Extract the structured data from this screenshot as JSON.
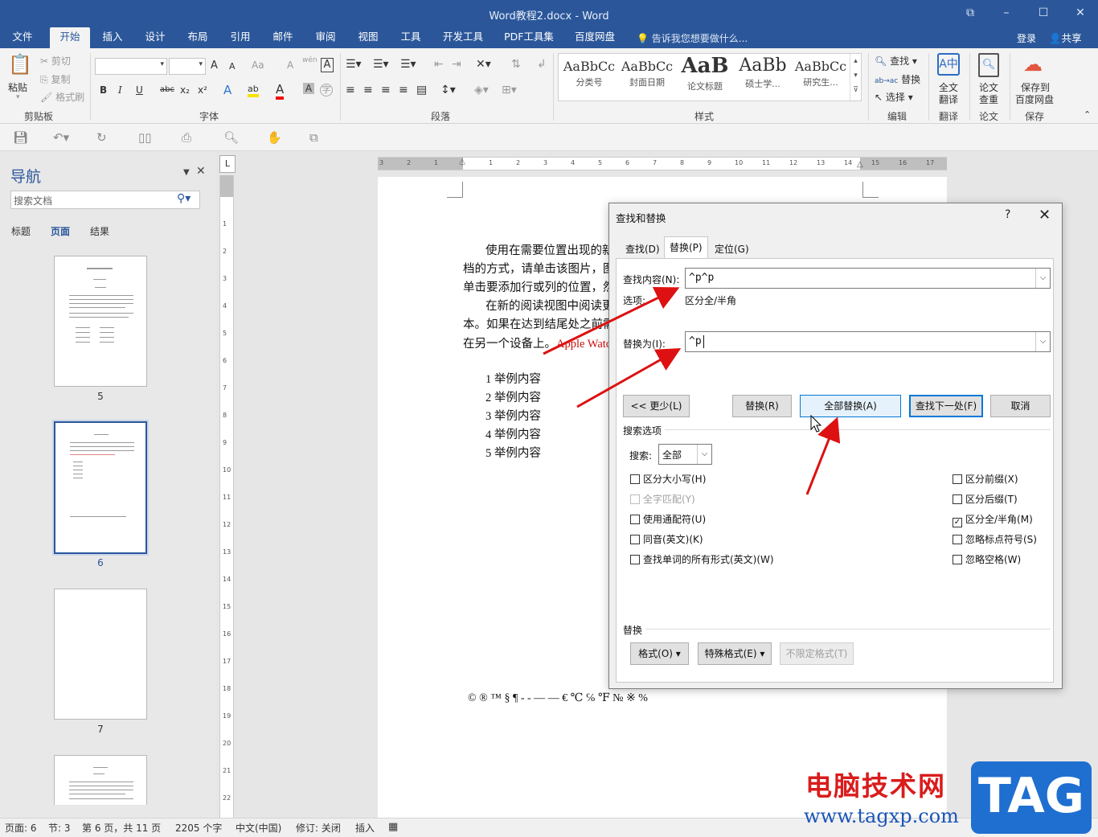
{
  "window": {
    "title": "Word教程2.docx - Word",
    "restore_icon": "ribbon-display-icon",
    "min": "–",
    "max": "☐",
    "close": "✕"
  },
  "menu": {
    "tabs": [
      "文件",
      "开始",
      "插入",
      "设计",
      "布局",
      "引用",
      "邮件",
      "审阅",
      "视图",
      "工具",
      "开发工具",
      "PDF工具集",
      "百度网盘"
    ],
    "active": "开始",
    "tell_me": "告诉我您想要做什么...",
    "login": "登录",
    "share": "共享"
  },
  "ribbon": {
    "clipboard": {
      "label": "剪贴板",
      "paste": "粘贴",
      "cut": "剪切",
      "copy": "复制",
      "format_painter": "格式刷"
    },
    "font": {
      "label": "字体",
      "font_name": "",
      "font_size": "",
      "grow": "A",
      "shrink": "A",
      "aa": "Aa",
      "clear": "A",
      "bold": "B",
      "italic": "I",
      "underline": "U",
      "strike": "abc",
      "sub": "x₂",
      "sup": "x²",
      "effect": "A",
      "highlight": "ab",
      "color": "A",
      "char_shade": "A",
      "enclose": "字",
      "phonetic": "wén",
      "border": "A"
    },
    "paragraph": {
      "label": "段落"
    },
    "styles": {
      "label": "样式",
      "items": [
        {
          "preview": "AaBbCc",
          "name": "分类号"
        },
        {
          "preview": "AaBbCc",
          "name": "封面日期"
        },
        {
          "preview": "AaB",
          "name": "论文标题"
        },
        {
          "preview": "AaBb",
          "name": "硕士学..."
        },
        {
          "preview": "AaBbCc",
          "name": "研究生..."
        }
      ]
    },
    "editing": {
      "label": "编辑",
      "find": "查找",
      "replace": "替换",
      "select": "选择"
    },
    "translate": {
      "label": "翻译",
      "btn": "全文\n翻译",
      "l1": "全文",
      "l2": "翻译"
    },
    "paper": {
      "label": "论文",
      "l1": "论文",
      "l2": "查重"
    },
    "save": {
      "label": "保存",
      "l1": "保存到",
      "l2": "百度网盘"
    }
  },
  "nav": {
    "title": "导航",
    "search_placeholder": "搜索文档",
    "tabs": [
      "标题",
      "页面",
      "结果"
    ],
    "active_tab": "页面",
    "pages": [
      "5",
      "6",
      "7"
    ]
  },
  "document": {
    "para1": [
      "使用在需要位置出现的新",
      "档的方式，请单击该图片，图",
      "单击要添加行或列的位置，然"
    ],
    "para2_lines": [
      "在新的阅读视图中阅读更",
      "本。如果在达到结尾处之前需"
    ],
    "para2_last": "在另一个设备上。",
    "para2_red": "Apple Watc",
    "list": [
      "1 举例内容",
      "2 举例内容",
      "3 举例内容",
      "4 举例内容",
      "5 举例内容"
    ],
    "symbols": "© ® ™ § ¶ - - — —  €  ℃  ℅  ℉  №  ※  %"
  },
  "dialog": {
    "title": "查找和替换",
    "help": "?",
    "close": "✕",
    "tabs": [
      "查找(D)",
      "替换(P)",
      "定位(G)"
    ],
    "active_tab": "替换(P)",
    "find_label": "查找内容(N):",
    "find_value": "^p^p",
    "options_label": "选项:",
    "options_value": "区分全/半角",
    "replace_label": "替换为(I):",
    "replace_value": "^p",
    "buttons": {
      "less": "<< 更少(L)",
      "replace": "替换(R)",
      "replace_all": "全部替换(A)",
      "find_next": "查找下一处(F)",
      "cancel": "取消"
    },
    "search_options_label": "搜索选项",
    "search_label": "搜索:",
    "search_value": "全部",
    "left_checks": [
      {
        "label": "区分大小写(H)",
        "checked": false,
        "disabled": false
      },
      {
        "label": "全字匹配(Y)",
        "checked": false,
        "disabled": true
      },
      {
        "label": "使用通配符(U)",
        "checked": false,
        "disabled": false
      },
      {
        "label": "同音(英文)(K)",
        "checked": false,
        "disabled": false
      },
      {
        "label": "查找单词的所有形式(英文)(W)",
        "checked": false,
        "disabled": false
      }
    ],
    "right_checks": [
      {
        "label": "区分前缀(X)",
        "checked": false
      },
      {
        "label": "区分后缀(T)",
        "checked": false
      },
      {
        "label": "区分全/半角(M)",
        "checked": true
      },
      {
        "label": "忽略标点符号(S)",
        "checked": false
      },
      {
        "label": "忽略空格(W)",
        "checked": false
      }
    ],
    "replace_section_label": "替换",
    "bottom_buttons": {
      "format": "格式(O) ▾",
      "special": "特殊格式(E) ▾",
      "no_format": "不限定格式(T)"
    }
  },
  "status": {
    "page": "页面: 6",
    "section": "节: 3",
    "pages": "第 6 页，共 11 页",
    "words": "2205 个字",
    "lang": "中文(中国)",
    "track": "修订: 关闭",
    "insert": "插入"
  },
  "watermark": {
    "text": "电脑技术网",
    "url": "www.tagxp.com",
    "tag": "TAG"
  },
  "colors": {
    "brand": "#2b579a",
    "arrow": "#dd1111",
    "accent": "#0078d7"
  }
}
